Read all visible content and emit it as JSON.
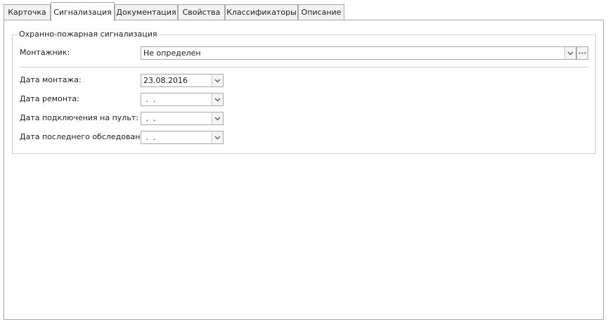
{
  "tabs": [
    {
      "label": "Карточка"
    },
    {
      "label": "Сигнализация"
    },
    {
      "label": "Документация"
    },
    {
      "label": "Свойства"
    },
    {
      "label": "Классификаторы"
    },
    {
      "label": "Описание"
    }
  ],
  "active_tab": "Сигнализация",
  "group": {
    "title": "Охранно-пожарная сигнализация",
    "installer_label": "Монтажник:",
    "installer_value": "Не определен",
    "fields": [
      {
        "label": "Дата монтажа:",
        "value": "23.08.2016"
      },
      {
        "label": "Дата ремонта:",
        "value": " .  ."
      },
      {
        "label": "Дата подключения на пульт:",
        "value": " .  ."
      },
      {
        "label": "Дата последнего обследования:",
        "value": " .  ."
      }
    ]
  },
  "icons": {
    "dropdown": "chevron-down-icon",
    "browse": "ellipsis-icon"
  },
  "colors": {
    "border": "#a9a9a9",
    "group_border": "#cfcfcf",
    "inactive_tab": "#f2f2f2"
  }
}
